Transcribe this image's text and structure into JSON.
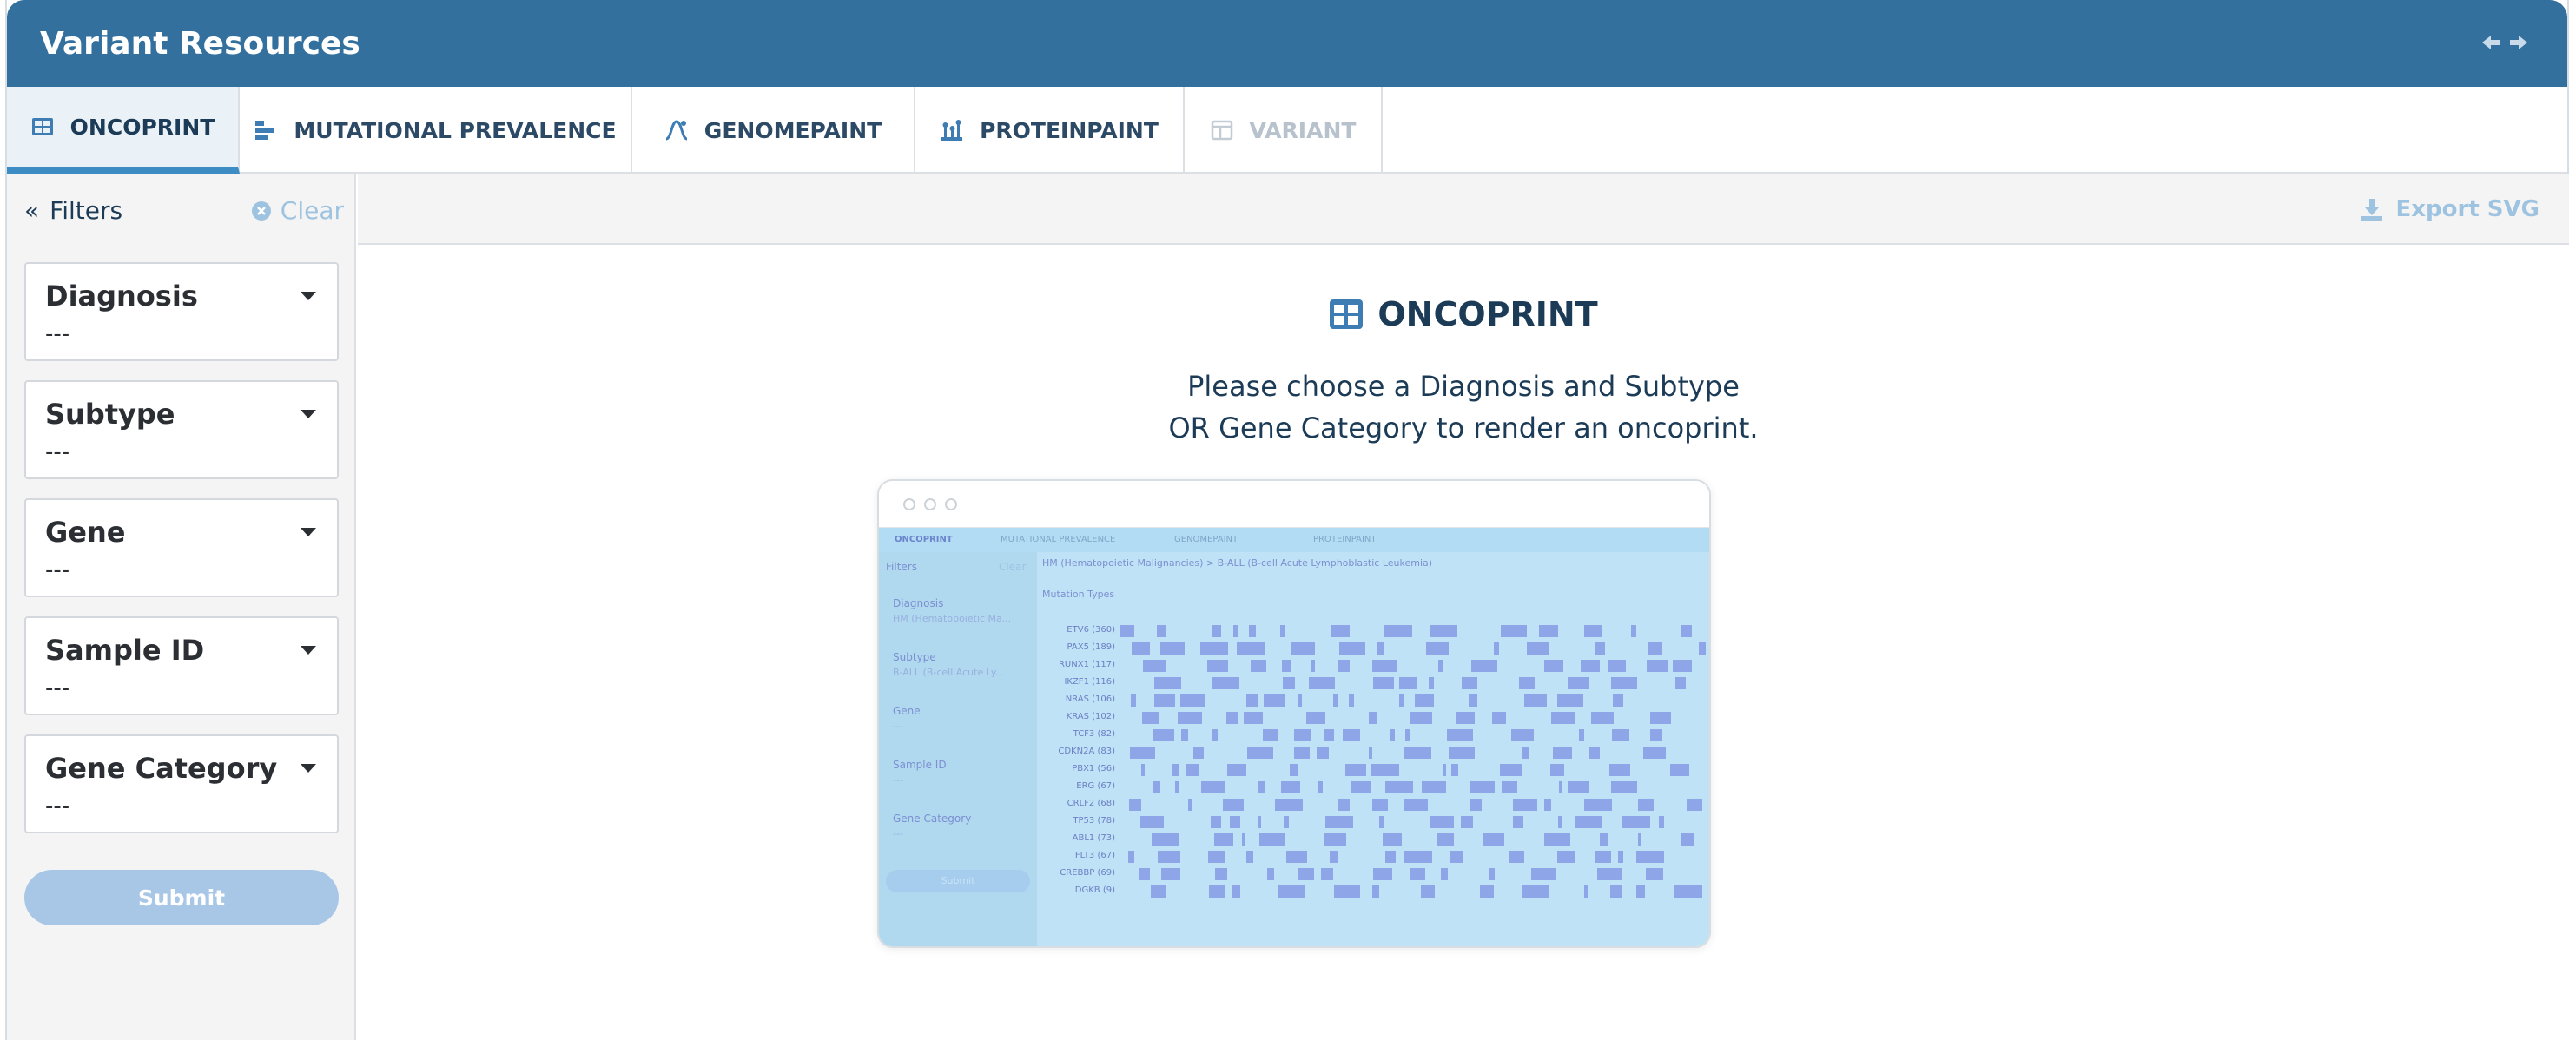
{
  "header": {
    "title": "Variant Resources",
    "expand_icon": "double-arrow-icon"
  },
  "tabs": [
    {
      "label": "ONCOPRINT",
      "icon": "grid-icon",
      "active": true
    },
    {
      "label": "MUTATIONAL PREVALENCE",
      "icon": "bars-icon"
    },
    {
      "label": "GENOMEPAINT",
      "icon": "genome-icon"
    },
    {
      "label": "PROTEINPAINT",
      "icon": "lollipop-icon"
    },
    {
      "label": "VARIANT",
      "icon": "table-icon",
      "disabled": true
    }
  ],
  "sidebar": {
    "filters_label": "Filters",
    "clear_label": "Clear",
    "filters": [
      {
        "label": "Diagnosis",
        "value": "---"
      },
      {
        "label": "Subtype",
        "value": "---"
      },
      {
        "label": "Gene",
        "value": "---"
      },
      {
        "label": "Sample ID",
        "value": "---"
      },
      {
        "label": "Gene Category",
        "value": "---"
      }
    ],
    "submit_label": "Submit"
  },
  "content": {
    "export_label": "Export SVG",
    "title": "ONCOPRINT",
    "message_line1": "Please choose a Diagnosis and Subtype",
    "message_line2": "OR Gene Category to render an oncoprint."
  },
  "preview": {
    "tabs": [
      "ONCOPRINT",
      "MUTATIONAL PREVALENCE",
      "GENOMEPAINT",
      "PROTEINPAINT"
    ],
    "filters_label": "Filters",
    "clear_label": "Clear",
    "breadcrumb": "HM (Hematopoietic Malignancies) > B-ALL (B-cell Acute Lymphoblastic Leukemia)",
    "mutation_types_label": "Mutation Types",
    "side_filters": [
      {
        "label": "Diagnosis",
        "value": "HM (Hematopoietic Ma..."
      },
      {
        "label": "Subtype",
        "value": "B-ALL (B-cell Acute Ly..."
      },
      {
        "label": "Gene",
        "value": "---"
      },
      {
        "label": "Sample ID",
        "value": "---"
      },
      {
        "label": "Gene Category",
        "value": "---"
      }
    ],
    "submit_label": "Submit",
    "genes": [
      "ETV6 (360)",
      "PAX5 (189)",
      "RUNX1 (117)",
      "IKZF1 (116)",
      "NRAS (106)",
      "KRAS (102)",
      "TCF3 (82)",
      "CDKN2A (83)",
      "PBX1 (56)",
      "ERG (67)",
      "CRLF2 (68)",
      "TP53 (78)",
      "ABL1 (73)",
      "FLT3 (67)",
      "CREBBP (69)",
      "DGKB (9)"
    ]
  }
}
